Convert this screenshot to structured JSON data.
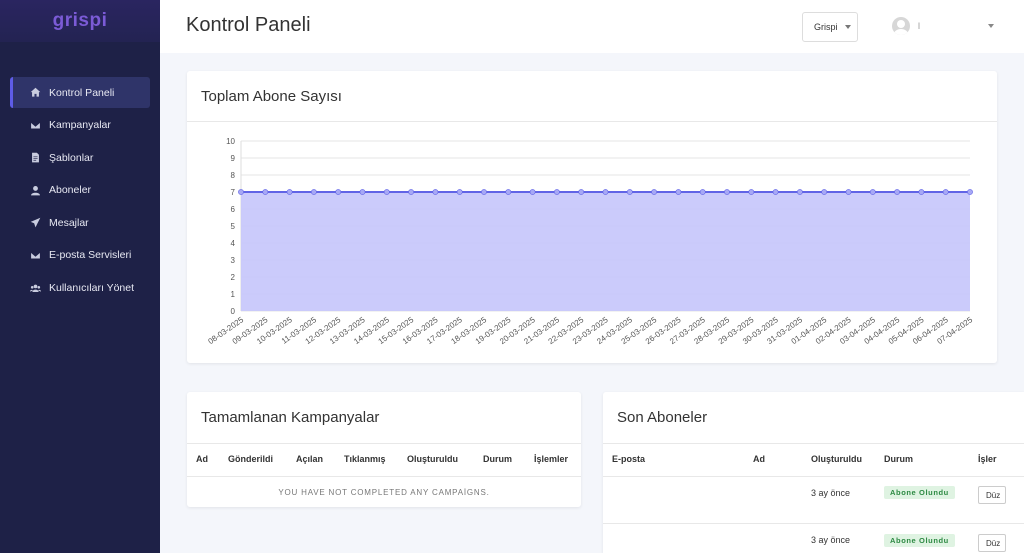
{
  "brand": "grispi",
  "sidebar": {
    "items": [
      {
        "label": "Kontrol Paneli",
        "icon": "home-icon",
        "active": true
      },
      {
        "label": "Kampanyalar",
        "icon": "envelope-icon",
        "active": false
      },
      {
        "label": "Şablonlar",
        "icon": "file-icon",
        "active": false
      },
      {
        "label": "Aboneler",
        "icon": "user-icon",
        "active": false
      },
      {
        "label": "Mesajlar",
        "icon": "paper-plane-icon",
        "active": false
      },
      {
        "label": "E-posta Servisleri",
        "icon": "envelope-icon",
        "active": false
      },
      {
        "label": "Kullanıcıları Yönet",
        "icon": "users-icon",
        "active": false
      }
    ]
  },
  "header": {
    "title": "Kontrol Paneli",
    "workspace": "Grispi",
    "user_name": "l"
  },
  "colors": {
    "sidebar_bg": "#1e2147",
    "accent": "#5e5ce6",
    "area_fill": "#c8c8fb",
    "line": "#6164e6"
  },
  "chart_card": {
    "title": "Toplam Abone Sayısı"
  },
  "chart_data": {
    "type": "area",
    "title": "Toplam Abone Sayısı",
    "x": [
      "08-03-2025",
      "09-03-2025",
      "10-03-2025",
      "11-03-2025",
      "12-03-2025",
      "13-03-2025",
      "14-03-2025",
      "15-03-2025",
      "16-03-2025",
      "17-03-2025",
      "18-03-2025",
      "19-03-2025",
      "20-03-2025",
      "21-03-2025",
      "22-03-2025",
      "23-03-2025",
      "24-03-2025",
      "25-03-2025",
      "26-03-2025",
      "27-03-2025",
      "28-03-2025",
      "29-03-2025",
      "30-03-2025",
      "31-03-2025",
      "01-04-2025",
      "02-04-2025",
      "03-04-2025",
      "04-04-2025",
      "05-04-2025",
      "06-04-2025",
      "07-04-2025"
    ],
    "series": [
      {
        "values": [
          7,
          7,
          7,
          7,
          7,
          7,
          7,
          7,
          7,
          7,
          7,
          7,
          7,
          7,
          7,
          7,
          7,
          7,
          7,
          7,
          7,
          7,
          7,
          7,
          7,
          7,
          7,
          7,
          7,
          7,
          7
        ]
      }
    ],
    "ylim": [
      0,
      10
    ],
    "yticks": [
      "0",
      "1",
      "2",
      "3",
      "4",
      "5",
      "6",
      "7",
      "8",
      "9",
      "10"
    ],
    "grid": true,
    "legend": "none"
  },
  "campaigns": {
    "title": "Tamamlanan Kampanyalar",
    "columns": [
      "Ad",
      "Gönderildi",
      "Açılan",
      "Tıklanmış",
      "Oluşturuldu",
      "Durum",
      "İşlemler"
    ],
    "empty_message": "YOU HAVE NOT COMPLETED ANY CAMPAİGNS."
  },
  "subscribers": {
    "title": "Son Aboneler",
    "columns": [
      "E-posta",
      "Ad",
      "Oluşturuldu",
      "Durum",
      "İşler"
    ],
    "rows": [
      {
        "email": "",
        "name": "",
        "created": "3 ay önce",
        "status": "Abone Olundu",
        "action": "Düz"
      },
      {
        "email": "",
        "name": "",
        "created": "3 ay önce",
        "status": "Abone Olundu",
        "action": "Düz"
      }
    ]
  }
}
